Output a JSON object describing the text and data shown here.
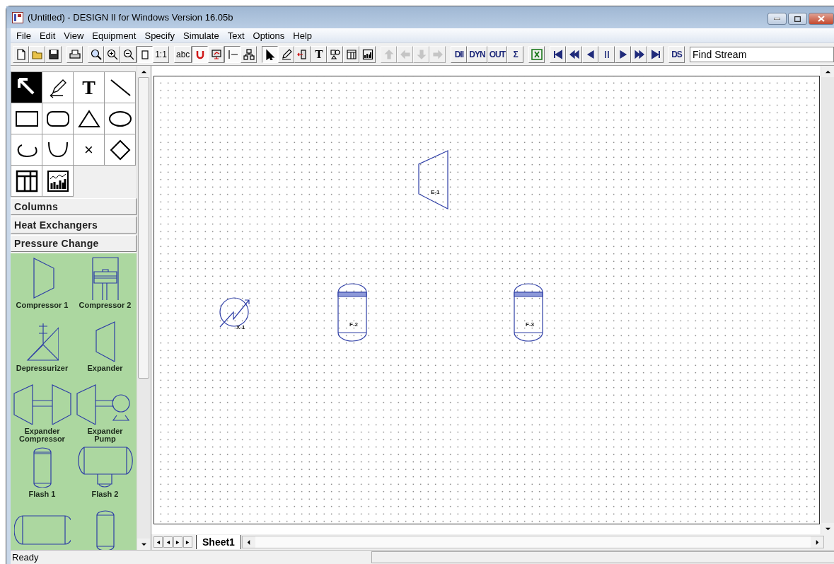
{
  "window": {
    "title": "(Untitled) - DESIGN II for Windows Version 16.05b"
  },
  "menu": [
    "File",
    "Edit",
    "View",
    "Equipment",
    "Specify",
    "Simulate",
    "Text",
    "Options",
    "Help"
  ],
  "toolbar": [
    [
      {
        "kind": "icon",
        "selected": false,
        "disabled": false
      },
      {
        "kind": "icon",
        "selected": false,
        "disabled": false
      },
      {
        "kind": "icon",
        "selected": false,
        "disabled": false
      }
    ],
    [
      {
        "kind": "icon",
        "selected": false,
        "disabled": false
      }
    ],
    [
      {
        "kind": "icon",
        "selected": false,
        "disabled": false
      },
      {
        "kind": "icon",
        "selected": false,
        "disabled": false
      },
      {
        "kind": "icon",
        "selected": false,
        "disabled": false
      },
      {
        "kind": "icon",
        "selected": true,
        "disabled": false
      },
      {
        "kind": "text",
        "label": "1:1",
        "selected": false,
        "disabled": false
      }
    ],
    [
      {
        "kind": "text",
        "label": "abc",
        "selected": false,
        "disabled": false
      },
      {
        "kind": "icon",
        "selected": true,
        "disabled": false
      },
      {
        "kind": "icon",
        "selected": false,
        "disabled": false
      },
      {
        "kind": "icon",
        "selected": true,
        "disabled": false
      },
      {
        "kind": "icon",
        "selected": false,
        "disabled": false
      }
    ],
    [
      {
        "kind": "icon",
        "selected": true,
        "disabled": false
      },
      {
        "kind": "icon",
        "selected": false,
        "disabled": false
      },
      {
        "kind": "icon",
        "selected": false,
        "disabled": false
      },
      {
        "kind": "text",
        "label": "T",
        "selected": false,
        "disabled": false
      },
      {
        "kind": "icon",
        "selected": false,
        "disabled": false
      },
      {
        "kind": "icon",
        "selected": false,
        "disabled": false
      },
      {
        "kind": "icon",
        "selected": false,
        "disabled": false
      }
    ],
    [
      {
        "kind": "icon",
        "selected": false,
        "disabled": true
      },
      {
        "kind": "icon",
        "selected": false,
        "disabled": true
      },
      {
        "kind": "icon",
        "selected": false,
        "disabled": true
      },
      {
        "kind": "icon",
        "selected": false,
        "disabled": true
      }
    ],
    [
      {
        "kind": "text",
        "label": "DII",
        "selected": false,
        "disabled": false
      },
      {
        "kind": "text",
        "label": "DYN",
        "selected": false,
        "disabled": false
      },
      {
        "kind": "text",
        "label": "OUT",
        "selected": false,
        "disabled": false
      },
      {
        "kind": "text",
        "label": "Σ",
        "selected": false,
        "disabled": false
      }
    ],
    [
      {
        "kind": "icon",
        "selected": false,
        "disabled": false
      }
    ],
    [
      {
        "kind": "icon",
        "selected": false,
        "disabled": false
      },
      {
        "kind": "icon",
        "selected": false,
        "disabled": false
      },
      {
        "kind": "icon",
        "selected": false,
        "disabled": false
      },
      {
        "kind": "icon",
        "selected": false,
        "disabled": false
      },
      {
        "kind": "icon",
        "selected": false,
        "disabled": false
      },
      {
        "kind": "icon",
        "selected": false,
        "disabled": false
      },
      {
        "kind": "icon",
        "selected": false,
        "disabled": false
      }
    ],
    [
      {
        "kind": "text",
        "label": "DS",
        "selected": false,
        "disabled": false
      }
    ]
  ],
  "find_stream": {
    "placeholder": "Find Stream"
  },
  "palette": [
    {
      "kind": "pointer",
      "selected": true
    },
    {
      "kind": "pencil",
      "selected": false
    },
    {
      "kind": "text",
      "label": "T",
      "selected": false
    },
    {
      "kind": "line",
      "selected": false
    },
    {
      "kind": "rectangle",
      "selected": false
    },
    {
      "kind": "rounded",
      "selected": false
    },
    {
      "kind": "triangle",
      "selected": false
    },
    {
      "kind": "ellipse",
      "selected": false
    },
    {
      "kind": "arc",
      "selected": false
    },
    {
      "kind": "curve",
      "selected": false
    },
    {
      "kind": "text",
      "label": "×",
      "selected": false
    },
    {
      "kind": "diamond",
      "selected": false
    },
    {
      "kind": "table",
      "selected": false
    },
    {
      "kind": "chart",
      "selected": false
    }
  ],
  "categories": [
    "Columns",
    "Heat Exchangers",
    "Pressure Change"
  ],
  "equipment": [
    {
      "kind": "compressor1",
      "label": "Compressor 1"
    },
    {
      "kind": "compressor2",
      "label": "Compressor 2"
    },
    {
      "kind": "depressurizer",
      "label": "Depressurizer"
    },
    {
      "kind": "expander",
      "label": "Expander"
    },
    {
      "kind": "expcomp",
      "label": "Expander Compressor"
    },
    {
      "kind": "exppump",
      "label": "Expander Pump"
    },
    {
      "kind": "flash1",
      "label": "Flash 1"
    },
    {
      "kind": "flash2",
      "label": "Flash 2"
    },
    {
      "kind": "flash3"
    },
    {
      "kind": "flash4"
    }
  ],
  "canvas_nodes": [
    {
      "kind": "expander",
      "label": "E-1"
    },
    {
      "kind": "exchanger",
      "label": "X-1"
    },
    {
      "kind": "flash",
      "label": "F-2"
    },
    {
      "kind": "flash",
      "label": "F-3"
    }
  ],
  "sheet_tabs": [
    {
      "label": "Sheet1",
      "selected": true
    }
  ],
  "status_bar": {
    "text": "Ready"
  }
}
